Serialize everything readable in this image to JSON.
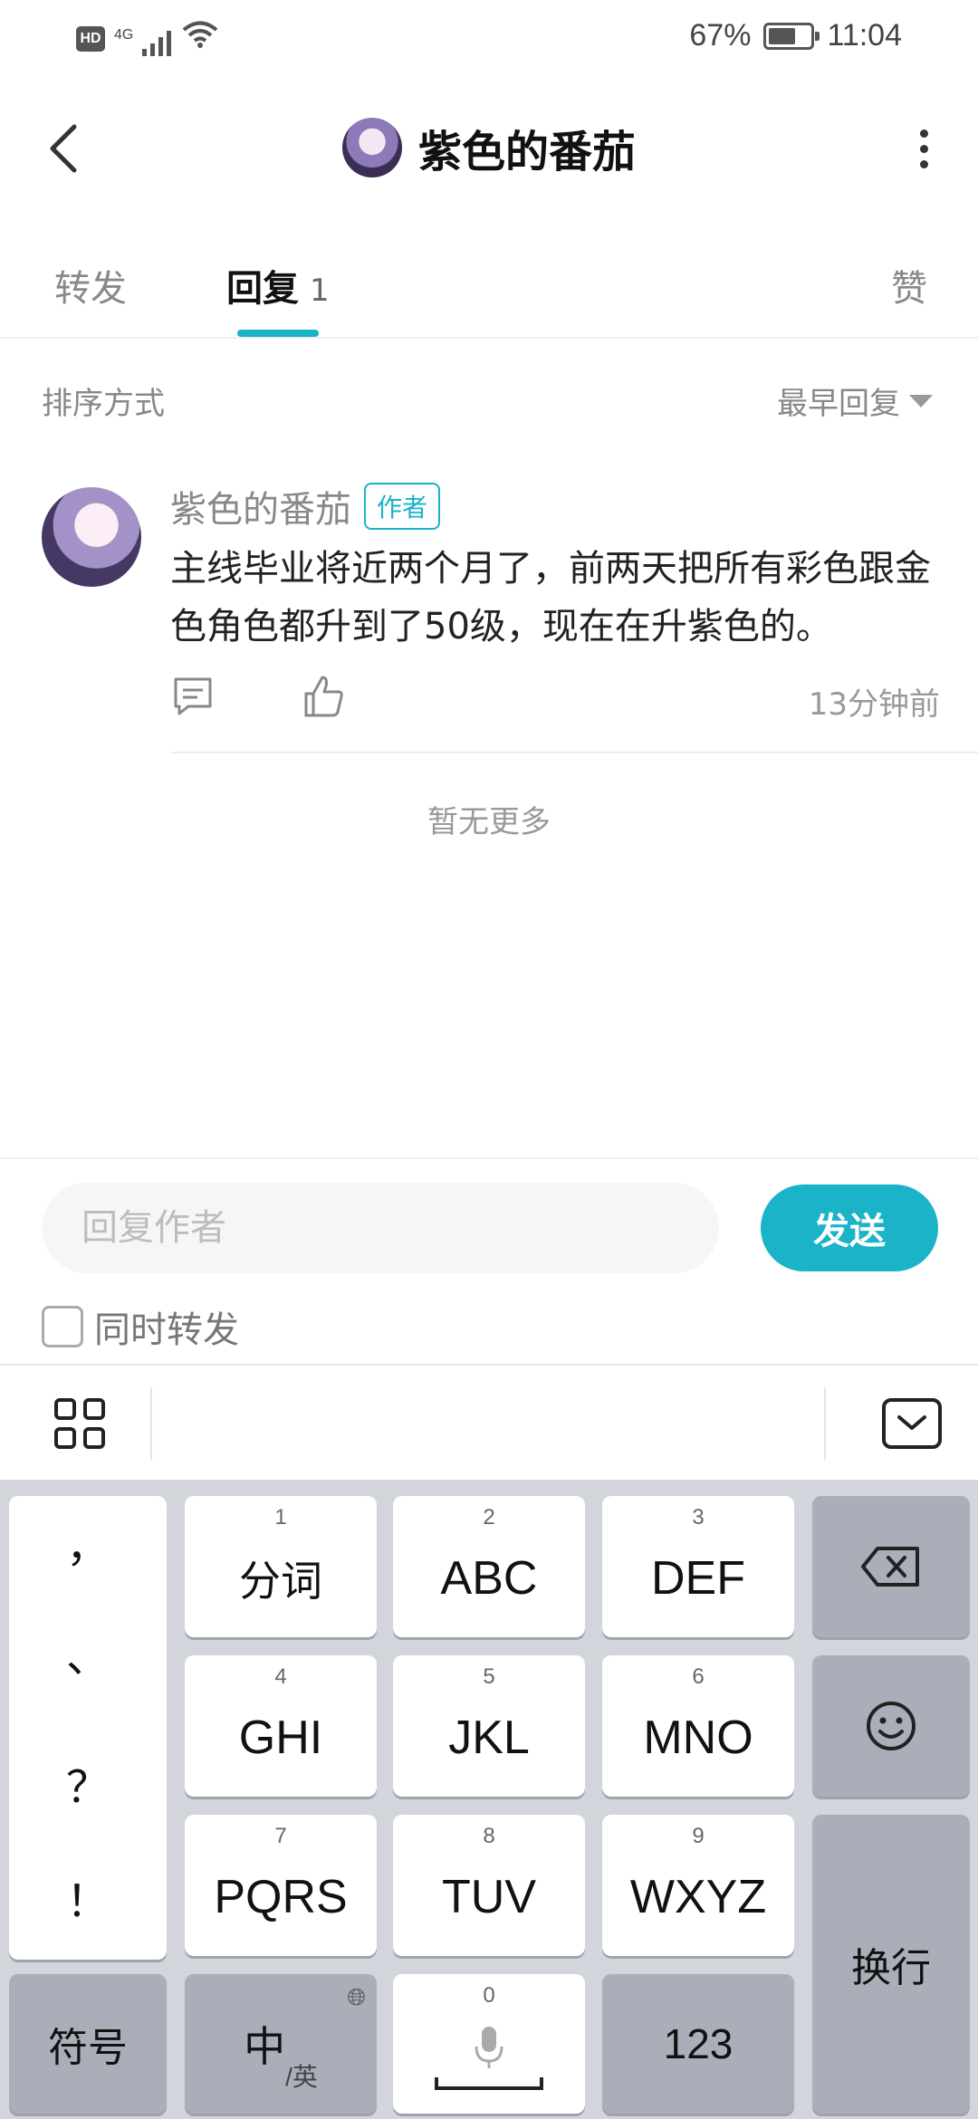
{
  "status_bar": {
    "hd": "HD",
    "network": "4G",
    "battery_percent": "67%",
    "battery_level": 0.67,
    "time": "11:04"
  },
  "header": {
    "title": "紫色的番茄",
    "back_icon": "chevron-left-icon",
    "more_icon": "more-vertical-icon"
  },
  "tabs": [
    {
      "label": "转发",
      "count": "",
      "active": false
    },
    {
      "label": "回复",
      "count": "1",
      "active": true
    },
    {
      "label": "赞",
      "count": "",
      "active": false
    }
  ],
  "sort": {
    "label": "排序方式",
    "value": "最早回复"
  },
  "comment": {
    "author": "紫色的番茄",
    "badge": "作者",
    "text": "主线毕业将近两个月了，前两天把所有彩色跟金色角色都升到了50级，现在在升紫色的。",
    "time": "13分钟前"
  },
  "no_more": "暂无更多",
  "reply": {
    "placeholder": "回复作者",
    "send_label": "发送",
    "forward_label": "同时转发"
  },
  "keyboard": {
    "punctuation": [
      "，",
      "、",
      "？",
      "！"
    ],
    "keys": [
      {
        "num": "1",
        "label": "分词"
      },
      {
        "num": "2",
        "label": "ABC"
      },
      {
        "num": "3",
        "label": "DEF"
      },
      {
        "num": "4",
        "label": "GHI"
      },
      {
        "num": "5",
        "label": "JKL"
      },
      {
        "num": "6",
        "label": "MNO"
      },
      {
        "num": "7",
        "label": "PQRS"
      },
      {
        "num": "8",
        "label": "TUV"
      },
      {
        "num": "9",
        "label": "WXYZ"
      }
    ],
    "symbol_label": "符号",
    "lang_main": "中",
    "lang_alt": "/英",
    "space_num": "0",
    "num_label": "123",
    "enter_label": "换行"
  },
  "colors": {
    "accent": "#1ab3c8",
    "keyboard_bg": "#d2d5dc",
    "key_gray": "#a9aeb8"
  }
}
